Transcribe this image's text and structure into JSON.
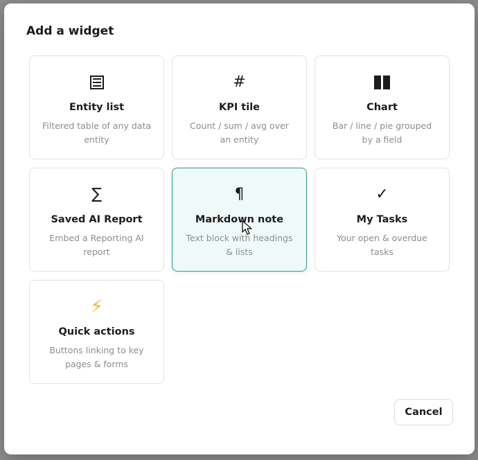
{
  "modal": {
    "title": "Add a widget",
    "cancel_label": "Cancel"
  },
  "widgets": [
    {
      "icon": "list-icon",
      "title": "Entity list",
      "description": "Filtered table of any data entity"
    },
    {
      "icon": "hash-icon",
      "glyph": "#",
      "title": "KPI tile",
      "description": "Count / sum / avg over an entity"
    },
    {
      "icon": "bar-chart-icon",
      "title": "Chart",
      "description": "Bar / line / pie grouped by a field"
    },
    {
      "icon": "sigma-icon",
      "glyph": "∑",
      "title": "Saved AI Report",
      "description": "Embed a Reporting AI report"
    },
    {
      "icon": "pilcrow-icon",
      "glyph": "¶",
      "title": "Markdown note",
      "description": "Text block with headings & lists",
      "selected": true
    },
    {
      "icon": "checkmark-icon",
      "glyph": "✓",
      "title": "My Tasks",
      "description": "Your open & overdue tasks"
    },
    {
      "icon": "lightning-icon",
      "glyph": "⚡",
      "title": "Quick actions",
      "description": "Buttons linking to key pages & forms"
    }
  ],
  "colors": {
    "selected_border": "#2d9c8a",
    "selected_bg": "#effaf8",
    "bolt": "#f2b71a"
  }
}
